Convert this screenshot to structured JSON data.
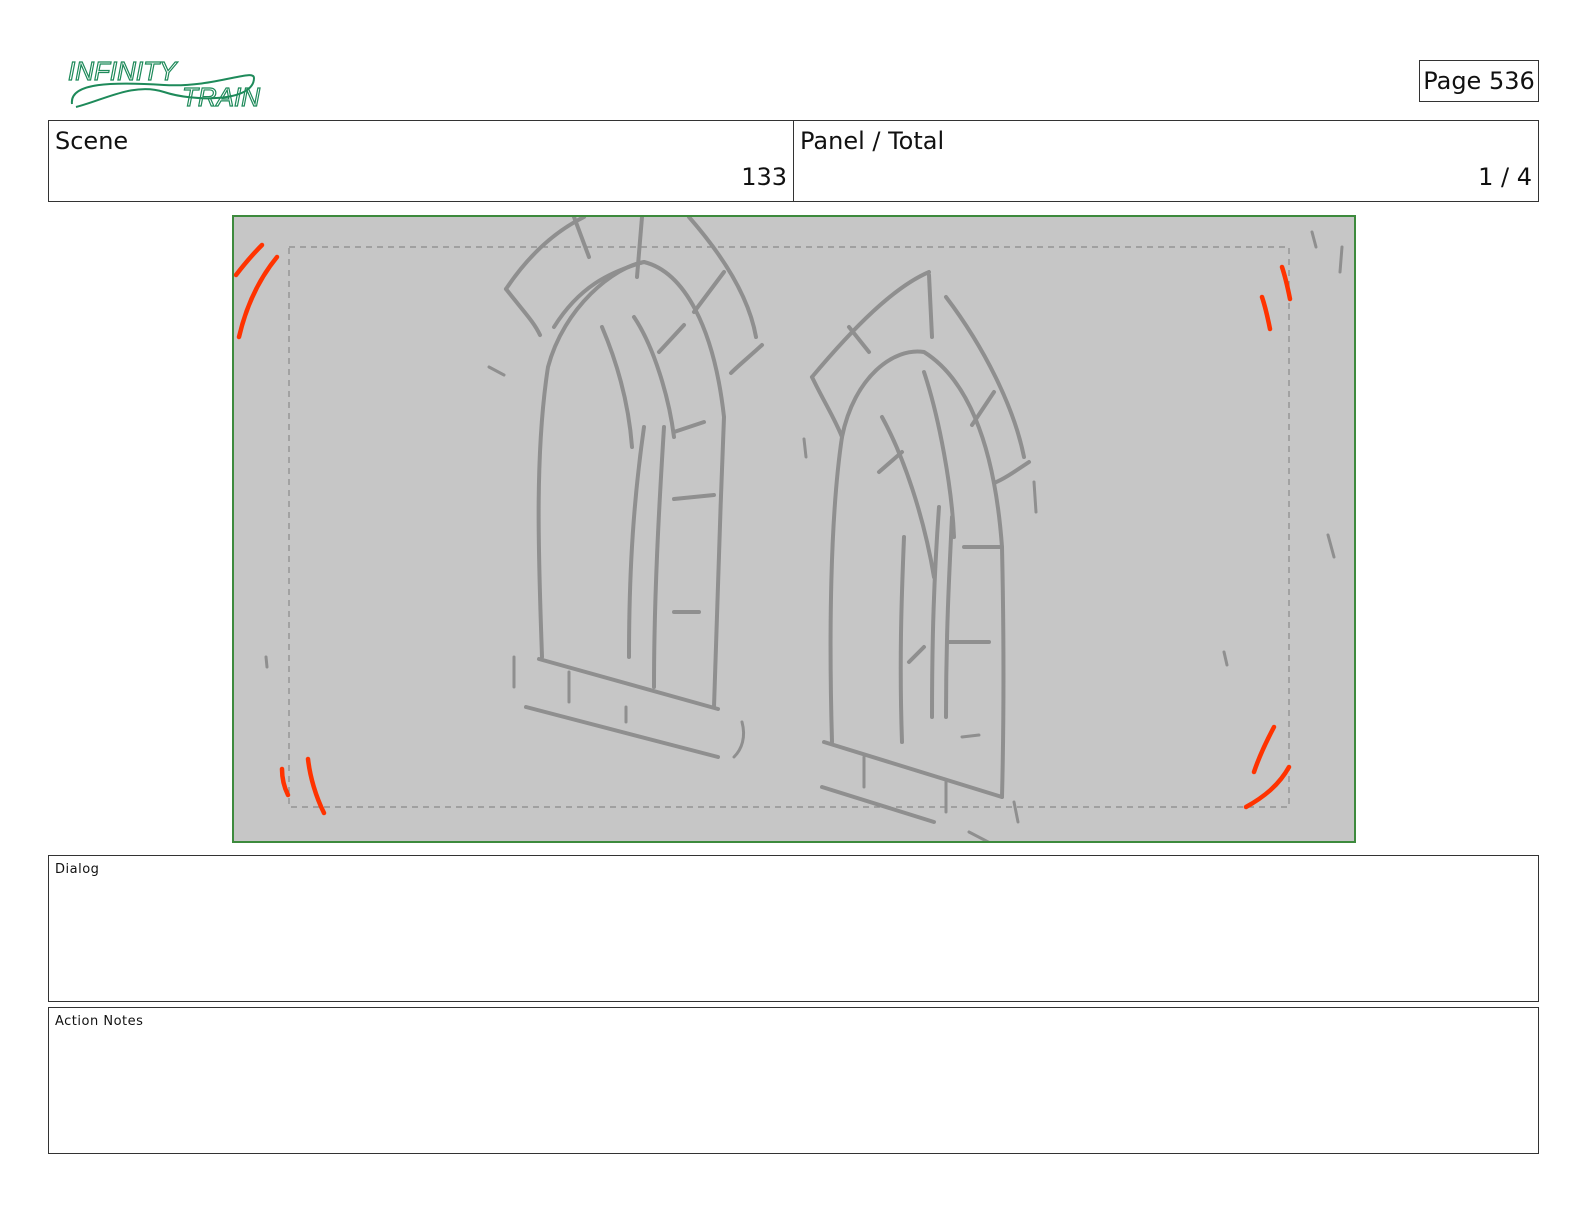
{
  "logo": {
    "line1": "INFINITY",
    "line2": "TRAIN",
    "color": "#1e8a5a"
  },
  "page": {
    "label": "Page 536"
  },
  "scene": {
    "label": "Scene",
    "value": "133"
  },
  "panel_total": {
    "label": "Panel / Total",
    "value": "1 / 4"
  },
  "panel_image": {
    "frame_color": "#3d8a3d",
    "background": "#c6c6c6",
    "sketch_color": "#8f8f8f",
    "mark_color": "#ff3300"
  },
  "dialog": {
    "label": "Dialog",
    "text": ""
  },
  "action_notes": {
    "label": "Action Notes",
    "text": ""
  }
}
